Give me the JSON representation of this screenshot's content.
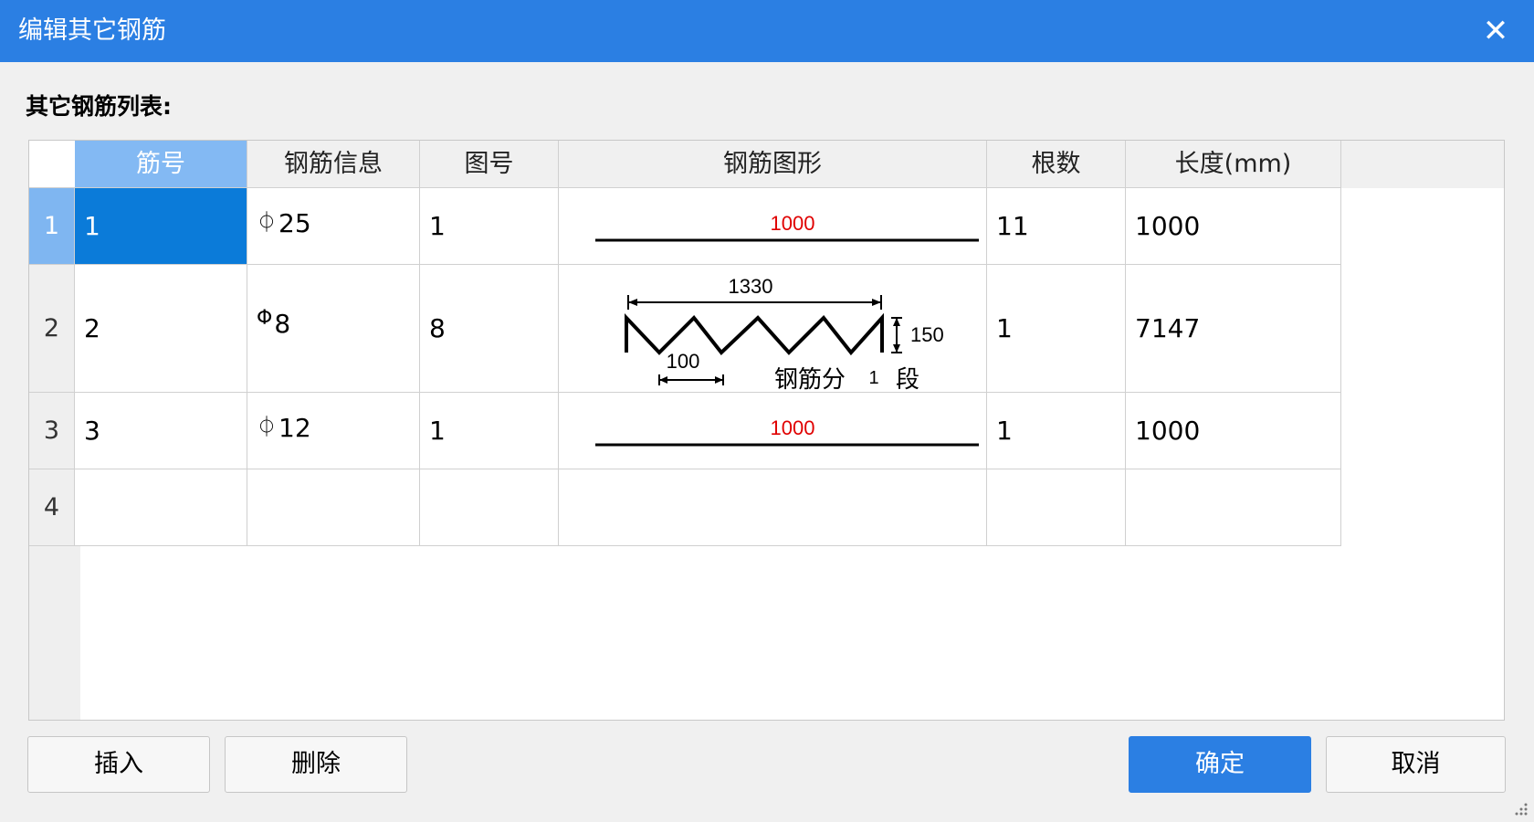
{
  "window": {
    "title": "编辑其它钢筋",
    "close_glyph": "✕"
  },
  "list_label": "其它钢筋列表:",
  "table": {
    "columns": [
      "筋号",
      "钢筋信息",
      "图号",
      "钢筋图形",
      "根数",
      "长度(mm)"
    ],
    "rows": [
      {
        "index": "1",
        "bar_no": "1",
        "grade_symbol": "⏀",
        "grade_value": "25",
        "figure_no": "1",
        "shape_label": "1000",
        "count": "11",
        "length": "1000"
      },
      {
        "index": "2",
        "bar_no": "2",
        "grade_symbol": "Φ",
        "grade_value": "8",
        "figure_no": "8",
        "shape": {
          "top_dim": "1330",
          "side_dim": "150",
          "pitch_dim": "100",
          "segments_prefix": "钢筋分",
          "segments_value": "1",
          "segments_suffix": "段"
        },
        "count": "1",
        "length": "7147"
      },
      {
        "index": "3",
        "bar_no": "3",
        "grade_symbol": "⏀",
        "grade_value": "12",
        "figure_no": "1",
        "shape_label": "1000",
        "count": "1",
        "length": "1000"
      },
      {
        "index": "4",
        "bar_no": "",
        "grade_symbol": "",
        "grade_value": "",
        "figure_no": "",
        "shape_label": "",
        "count": "",
        "length": ""
      }
    ]
  },
  "buttons": {
    "insert": "插入",
    "delete": "删除",
    "ok": "确定",
    "cancel": "取消"
  },
  "colors": {
    "titlebar": "#2b7fe3",
    "selection": "#0b7bd9",
    "dimension_text": "#e00000",
    "primary_button": "#2b7fe3"
  }
}
